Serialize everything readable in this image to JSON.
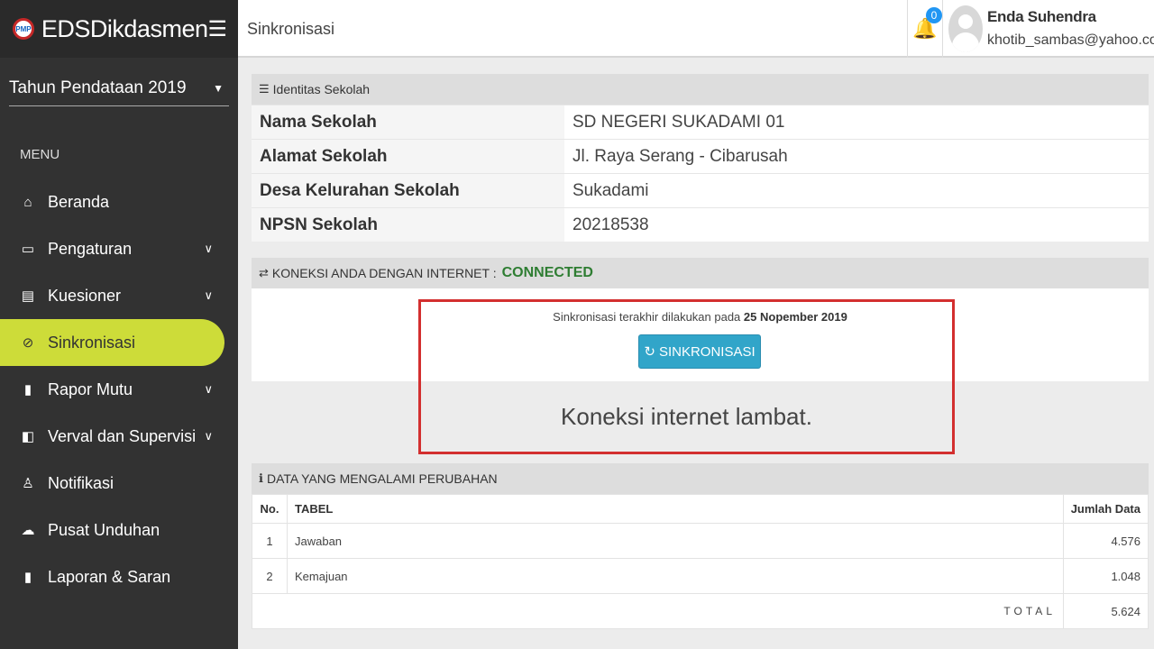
{
  "brand": {
    "name": "EDSDikdasmen",
    "logo_text": "PMP"
  },
  "sidebar": {
    "year": "Tahun Pendataan 2019",
    "menu_title": "MENU",
    "items": [
      {
        "label": "Beranda",
        "icon": "home-icon"
      },
      {
        "label": "Pengaturan",
        "icon": "monitor-icon"
      },
      {
        "label": "Kuesioner",
        "icon": "form-icon"
      },
      {
        "label": "Sinkronisasi",
        "icon": "check-circle-icon"
      },
      {
        "label": "Rapor Mutu",
        "icon": "book-icon"
      },
      {
        "label": "Verval dan Supervisi",
        "icon": "door-icon"
      },
      {
        "label": "Notifikasi",
        "icon": "bell-icon"
      },
      {
        "label": "Pusat Unduhan",
        "icon": "cloud-download-icon"
      },
      {
        "label": "Laporan & Saran",
        "icon": "book-icon"
      }
    ]
  },
  "topbar": {
    "title": "Sinkronisasi",
    "notif_count": "0",
    "user_name": "Enda Suhendra",
    "user_email": "khotib_sambas@yahoo.com"
  },
  "identitas": {
    "heading": "Identitas Sekolah",
    "rows": [
      {
        "label": "Nama Sekolah",
        "value": "SD NEGERI SUKADAMI 01"
      },
      {
        "label": "Alamat Sekolah",
        "value": "Jl. Raya Serang - Cibarusah"
      },
      {
        "label": "Desa Kelurahan Sekolah",
        "value": "Sukadami"
      },
      {
        "label": "NPSN Sekolah",
        "value": "20218538"
      }
    ]
  },
  "koneksi": {
    "heading": "KONEKSI ANDA DENGAN INTERNET :",
    "status": "CONNECTED",
    "sync_info": "Sinkronisasi terakhir dilakukan pada",
    "sync_date": "25 Nopember 2019",
    "button": "SINKRONISASI",
    "message": "Koneksi internet lambat."
  },
  "perubahan": {
    "heading": "DATA YANG MENGALAMI PERUBAHAN",
    "columns": [
      "No.",
      "TABEL",
      "Jumlah Data"
    ],
    "rows": [
      {
        "no": "1",
        "tabel": "Jawaban",
        "jumlah": "4.576"
      },
      {
        "no": "2",
        "tabel": "Kemajuan",
        "jumlah": "1.048"
      }
    ],
    "total_label": "TOTAL",
    "total": "5.624"
  },
  "colors": {
    "accent": "#cddc39",
    "sidebar": "#323232",
    "button": "#31a5c9",
    "connected": "#2e7d32",
    "highlight_box": "#d32f2f"
  }
}
